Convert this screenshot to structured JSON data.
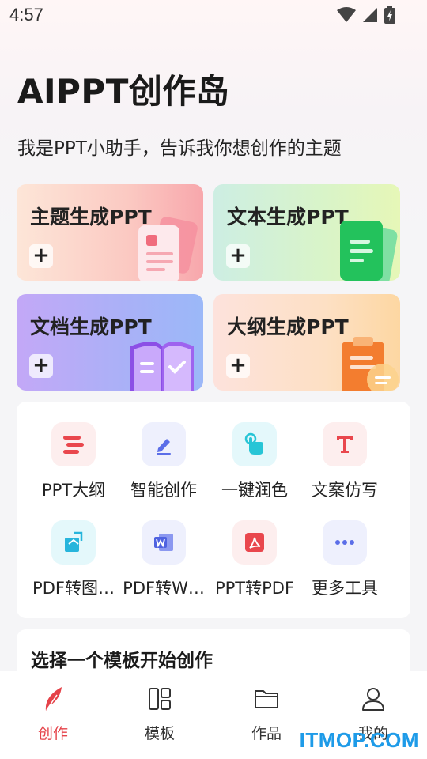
{
  "status_bar": {
    "time": "4:57"
  },
  "header": {
    "title": "AIPPT创作岛",
    "subtitle": "我是PPT小助手，告诉我你想创作的主题"
  },
  "cards": [
    {
      "title": "主题生成PPT",
      "plus": "+"
    },
    {
      "title": "文本生成PPT",
      "plus": "+"
    },
    {
      "title": "文档生成PPT",
      "plus": "+"
    },
    {
      "title": "大纲生成PPT",
      "plus": "+"
    }
  ],
  "tools": [
    {
      "label": "PPT大纲",
      "icon": "outline-lines-icon",
      "color": "#e9474d"
    },
    {
      "label": "智能创作",
      "icon": "pen-icon",
      "color": "#5b6ee8"
    },
    {
      "label": "一键润色",
      "icon": "tap-hand-icon",
      "color": "#27c5d6"
    },
    {
      "label": "文案仿写",
      "icon": "text-t-icon",
      "color": "#e9474d"
    },
    {
      "label": "PDF转图…",
      "icon": "pdf-to-image-icon",
      "color": "#27b5dc"
    },
    {
      "label": "PDF转W…",
      "icon": "word-icon",
      "color": "#4f62e0"
    },
    {
      "label": "PPT转PDF",
      "icon": "pdf-icon",
      "color": "#e9474d"
    },
    {
      "label": "更多工具",
      "icon": "more-dots-icon",
      "color": "#5b6ee8"
    }
  ],
  "template_section": {
    "title": "选择一个模板开始创作"
  },
  "tabbar": {
    "tabs": [
      {
        "label": "创作",
        "icon": "feather-icon",
        "active": true
      },
      {
        "label": "模板",
        "icon": "template-grid-icon",
        "active": false
      },
      {
        "label": "作品",
        "icon": "folder-icon",
        "active": false
      },
      {
        "label": "我的",
        "icon": "user-icon",
        "active": false
      }
    ],
    "active_color": "#e5434a"
  },
  "watermark": "ITMOP.COM"
}
